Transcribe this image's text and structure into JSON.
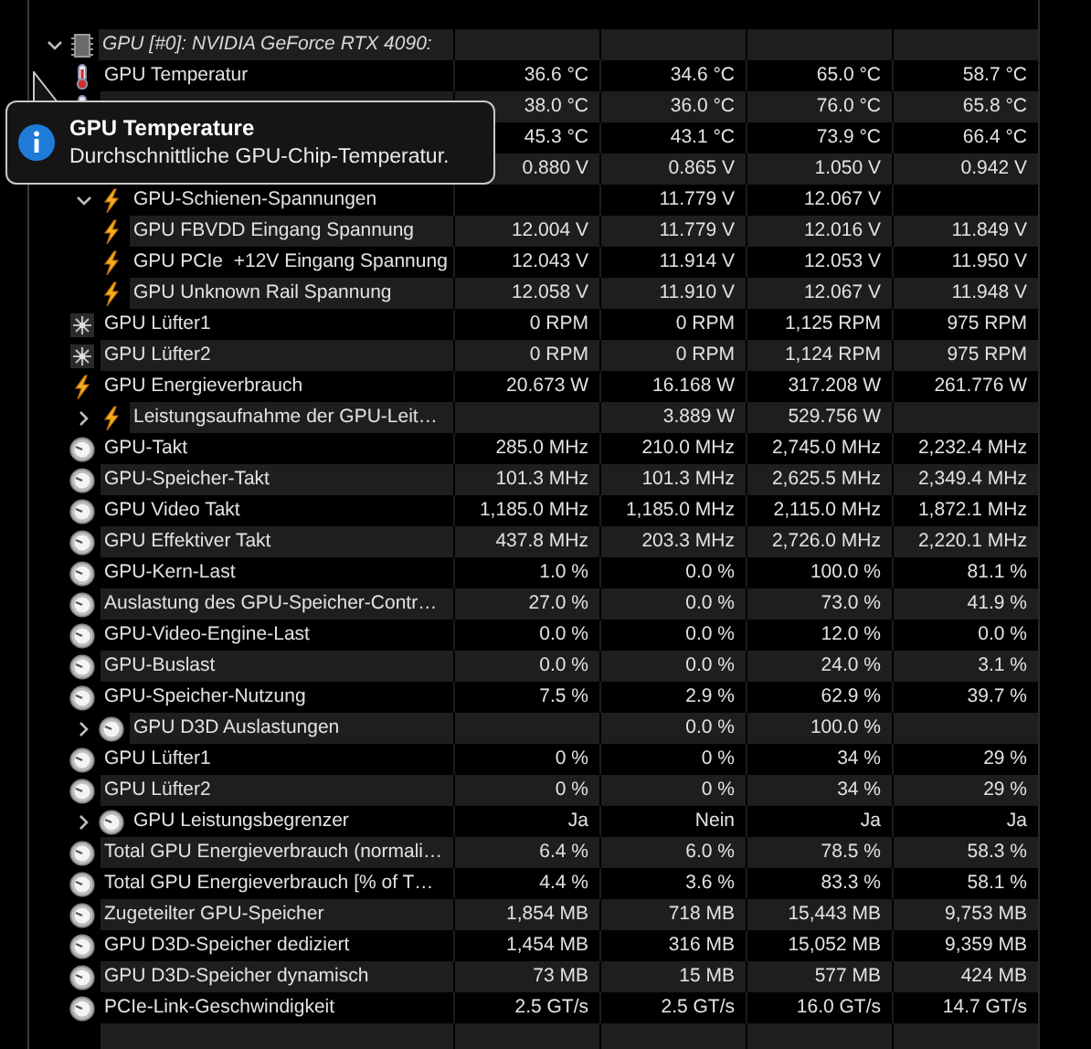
{
  "device": {
    "label": "GPU [#0]: NVIDIA GeForce RTX 4090:",
    "expanded": true
  },
  "sensors": [
    {
      "kind": "temp",
      "label": "GPU Temperatur",
      "values": {
        "column_1": "36.6 °C",
        "column_2": "34.6 °C",
        "column_3": "65.0 °C",
        "column_4": "58.7 °C"
      }
    },
    {
      "kind": "temp",
      "values": {
        "column_1": "38.0 °C",
        "column_2": "36.0 °C",
        "column_3": "76.0 °C",
        "column_4": "65.8 °C"
      }
    },
    {
      "values": {
        "column_1": "45.3 °C",
        "column_2": "43.1 °C",
        "column_3": "73.9 °C",
        "column_4": "66.4 °C"
      }
    },
    {
      "values": {
        "column_1": "0.880 V",
        "column_2": "0.865 V",
        "column_3": "1.050 V",
        "column_4": "0.942 V"
      }
    },
    {
      "kind": "volt",
      "label": "GPU-Schienen-Spannungen",
      "expanded": true,
      "values": {
        "column_2": "11.779 V",
        "column_3": "12.067 V"
      },
      "children": [
        {
          "kind": "volt",
          "label": "GPU FBVDD Eingang Spannung",
          "values": {
            "column_1": "12.004 V",
            "column_2": "11.779 V",
            "column_3": "12.016 V",
            "column_4": "11.849 V"
          }
        },
        {
          "kind": "volt",
          "label": "GPU PCIe  +12V Eingang Spannung",
          "values": {
            "column_1": "12.043 V",
            "column_2": "11.914 V",
            "column_3": "12.053 V",
            "column_4": "11.950 V"
          }
        },
        {
          "kind": "volt",
          "label": "GPU Unknown Rail Spannung",
          "values": {
            "column_1": "12.058 V",
            "column_2": "11.910 V",
            "column_3": "12.067 V",
            "column_4": "11.948 V"
          }
        }
      ]
    },
    {
      "kind": "fan",
      "label": "GPU Lüfter1",
      "values": {
        "column_1": "0 RPM",
        "column_2": "0 RPM",
        "column_3": "1,125 RPM",
        "column_4": "975 RPM"
      }
    },
    {
      "kind": "fan",
      "label": "GPU Lüfter2",
      "values": {
        "column_1": "0 RPM",
        "column_2": "0 RPM",
        "column_3": "1,124 RPM",
        "column_4": "975 RPM"
      }
    },
    {
      "kind": "volt",
      "label": "GPU Energieverbrauch",
      "values": {
        "column_1": "20.673 W",
        "column_2": "16.168 W",
        "column_3": "317.208 W",
        "column_4": "261.776 W"
      }
    },
    {
      "kind": "volt",
      "label": "Leistungsaufnahme der GPU-Leit…",
      "expanded": false,
      "values": {
        "column_2": "3.889 W",
        "column_3": "529.756 W"
      }
    },
    {
      "kind": "clock",
      "label": "GPU-Takt",
      "values": {
        "column_1": "285.0 MHz",
        "column_2": "210.0 MHz",
        "column_3": "2,745.0 MHz",
        "column_4": "2,232.4 MHz"
      }
    },
    {
      "kind": "clock",
      "label": "GPU-Speicher-Takt",
      "values": {
        "column_1": "101.3 MHz",
        "column_2": "101.3 MHz",
        "column_3": "2,625.5 MHz",
        "column_4": "2,349.4 MHz"
      }
    },
    {
      "kind": "clock",
      "label": "GPU Video Takt",
      "values": {
        "column_1": "1,185.0 MHz",
        "column_2": "1,185.0 MHz",
        "column_3": "2,115.0 MHz",
        "column_4": "1,872.1 MHz"
      }
    },
    {
      "kind": "clock",
      "label": "GPU Effektiver Takt",
      "values": {
        "column_1": "437.8 MHz",
        "column_2": "203.3 MHz",
        "column_3": "2,726.0 MHz",
        "column_4": "2,220.1 MHz"
      }
    },
    {
      "kind": "clock",
      "label": "GPU-Kern-Last",
      "values": {
        "column_1": "1.0 %",
        "column_2": "0.0 %",
        "column_3": "100.0 %",
        "column_4": "81.1 %"
      }
    },
    {
      "kind": "clock",
      "label": "Auslastung des GPU-Speicher-Contr…",
      "values": {
        "column_1": "27.0 %",
        "column_2": "0.0 %",
        "column_3": "73.0 %",
        "column_4": "41.9 %"
      }
    },
    {
      "kind": "clock",
      "label": "GPU-Video-Engine-Last",
      "values": {
        "column_1": "0.0 %",
        "column_2": "0.0 %",
        "column_3": "12.0 %",
        "column_4": "0.0 %"
      }
    },
    {
      "kind": "clock",
      "label": "GPU-Buslast",
      "values": {
        "column_1": "0.0 %",
        "column_2": "0.0 %",
        "column_3": "24.0 %",
        "column_4": "3.1 %"
      }
    },
    {
      "kind": "clock",
      "label": "GPU-Speicher-Nutzung",
      "values": {
        "column_1": "7.5 %",
        "column_2": "2.9 %",
        "column_3": "62.9 %",
        "column_4": "39.7 %"
      }
    },
    {
      "kind": "clock",
      "label": "GPU D3D Auslastungen",
      "expanded": false,
      "values": {
        "column_2": "0.0 %",
        "column_3": "100.0 %"
      }
    },
    {
      "kind": "clock",
      "label": "GPU Lüfter1",
      "values": {
        "column_1": "0 %",
        "column_2": "0 %",
        "column_3": "34 %",
        "column_4": "29 %"
      }
    },
    {
      "kind": "clock",
      "label": "GPU Lüfter2",
      "values": {
        "column_1": "0 %",
        "column_2": "0 %",
        "column_3": "34 %",
        "column_4": "29 %"
      }
    },
    {
      "kind": "clock",
      "label": "GPU Leistungsbegrenzer",
      "expanded": false,
      "values": {
        "column_1": "Ja",
        "column_2": "Nein",
        "column_3": "Ja",
        "column_4": "Ja"
      }
    },
    {
      "kind": "clock",
      "label": "Total GPU Energieverbrauch (normali…",
      "values": {
        "column_1": "6.4 %",
        "column_2": "6.0 %",
        "column_3": "78.5 %",
        "column_4": "58.3 %"
      }
    },
    {
      "kind": "clock",
      "label": "Total GPU Energieverbrauch [% of T…",
      "values": {
        "column_1": "4.4 %",
        "column_2": "3.6 %",
        "column_3": "83.3 %",
        "column_4": "58.1 %"
      }
    },
    {
      "kind": "clock",
      "label": "Zugeteilter GPU-Speicher",
      "values": {
        "column_1": "1,854 MB",
        "column_2": "718 MB",
        "column_3": "15,443 MB",
        "column_4": "9,753 MB"
      }
    },
    {
      "kind": "clock",
      "label": "GPU D3D-Speicher dediziert",
      "values": {
        "column_1": "1,454 MB",
        "column_2": "316 MB",
        "column_3": "15,052 MB",
        "column_4": "9,359 MB"
      }
    },
    {
      "kind": "clock",
      "label": "GPU D3D-Speicher dynamisch",
      "values": {
        "column_1": "73 MB",
        "column_2": "15 MB",
        "column_3": "577 MB",
        "column_4": "424 MB"
      }
    },
    {
      "kind": "clock",
      "label": "PCIe-Link-Geschwindigkeit",
      "values": {
        "column_1": "2.5 GT/s",
        "column_2": "2.5 GT/s",
        "column_3": "16.0 GT/s",
        "column_4": "14.7 GT/s"
      }
    }
  ],
  "tooltip": {
    "title": "GPU Temperature",
    "text": "Durchschnittliche GPU-Chip-Temperatur."
  }
}
